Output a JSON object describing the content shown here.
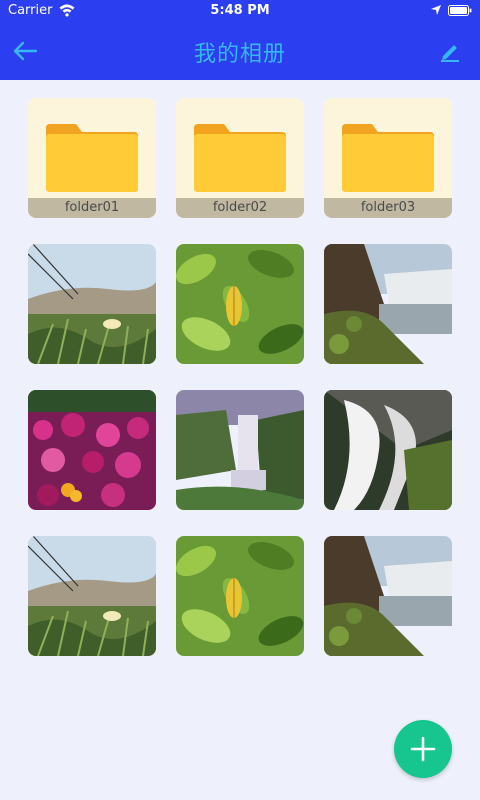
{
  "status_bar": {
    "carrier": "Carrier",
    "time": "5:48 PM"
  },
  "nav": {
    "title": "我的相册",
    "back_icon": "arrow-left-icon",
    "edit_icon": "pencil-icon",
    "background": "#2c3ff0",
    "title_color": "#36b6f5"
  },
  "folders": [
    {
      "name": "folder01"
    },
    {
      "name": "folder02"
    },
    {
      "name": "folder03"
    }
  ],
  "photos": [
    {
      "scene": "beach-flowers"
    },
    {
      "scene": "green-leaves"
    },
    {
      "scene": "waterfall-lake"
    },
    {
      "scene": "pink-flowers"
    },
    {
      "scene": "waterfall-valley"
    },
    {
      "scene": "white-waterfall"
    },
    {
      "scene": "beach-flowers"
    },
    {
      "scene": "green-leaves"
    },
    {
      "scene": "waterfall-lake"
    }
  ],
  "fab": {
    "icon": "plus-icon",
    "color": "#17c58e"
  }
}
